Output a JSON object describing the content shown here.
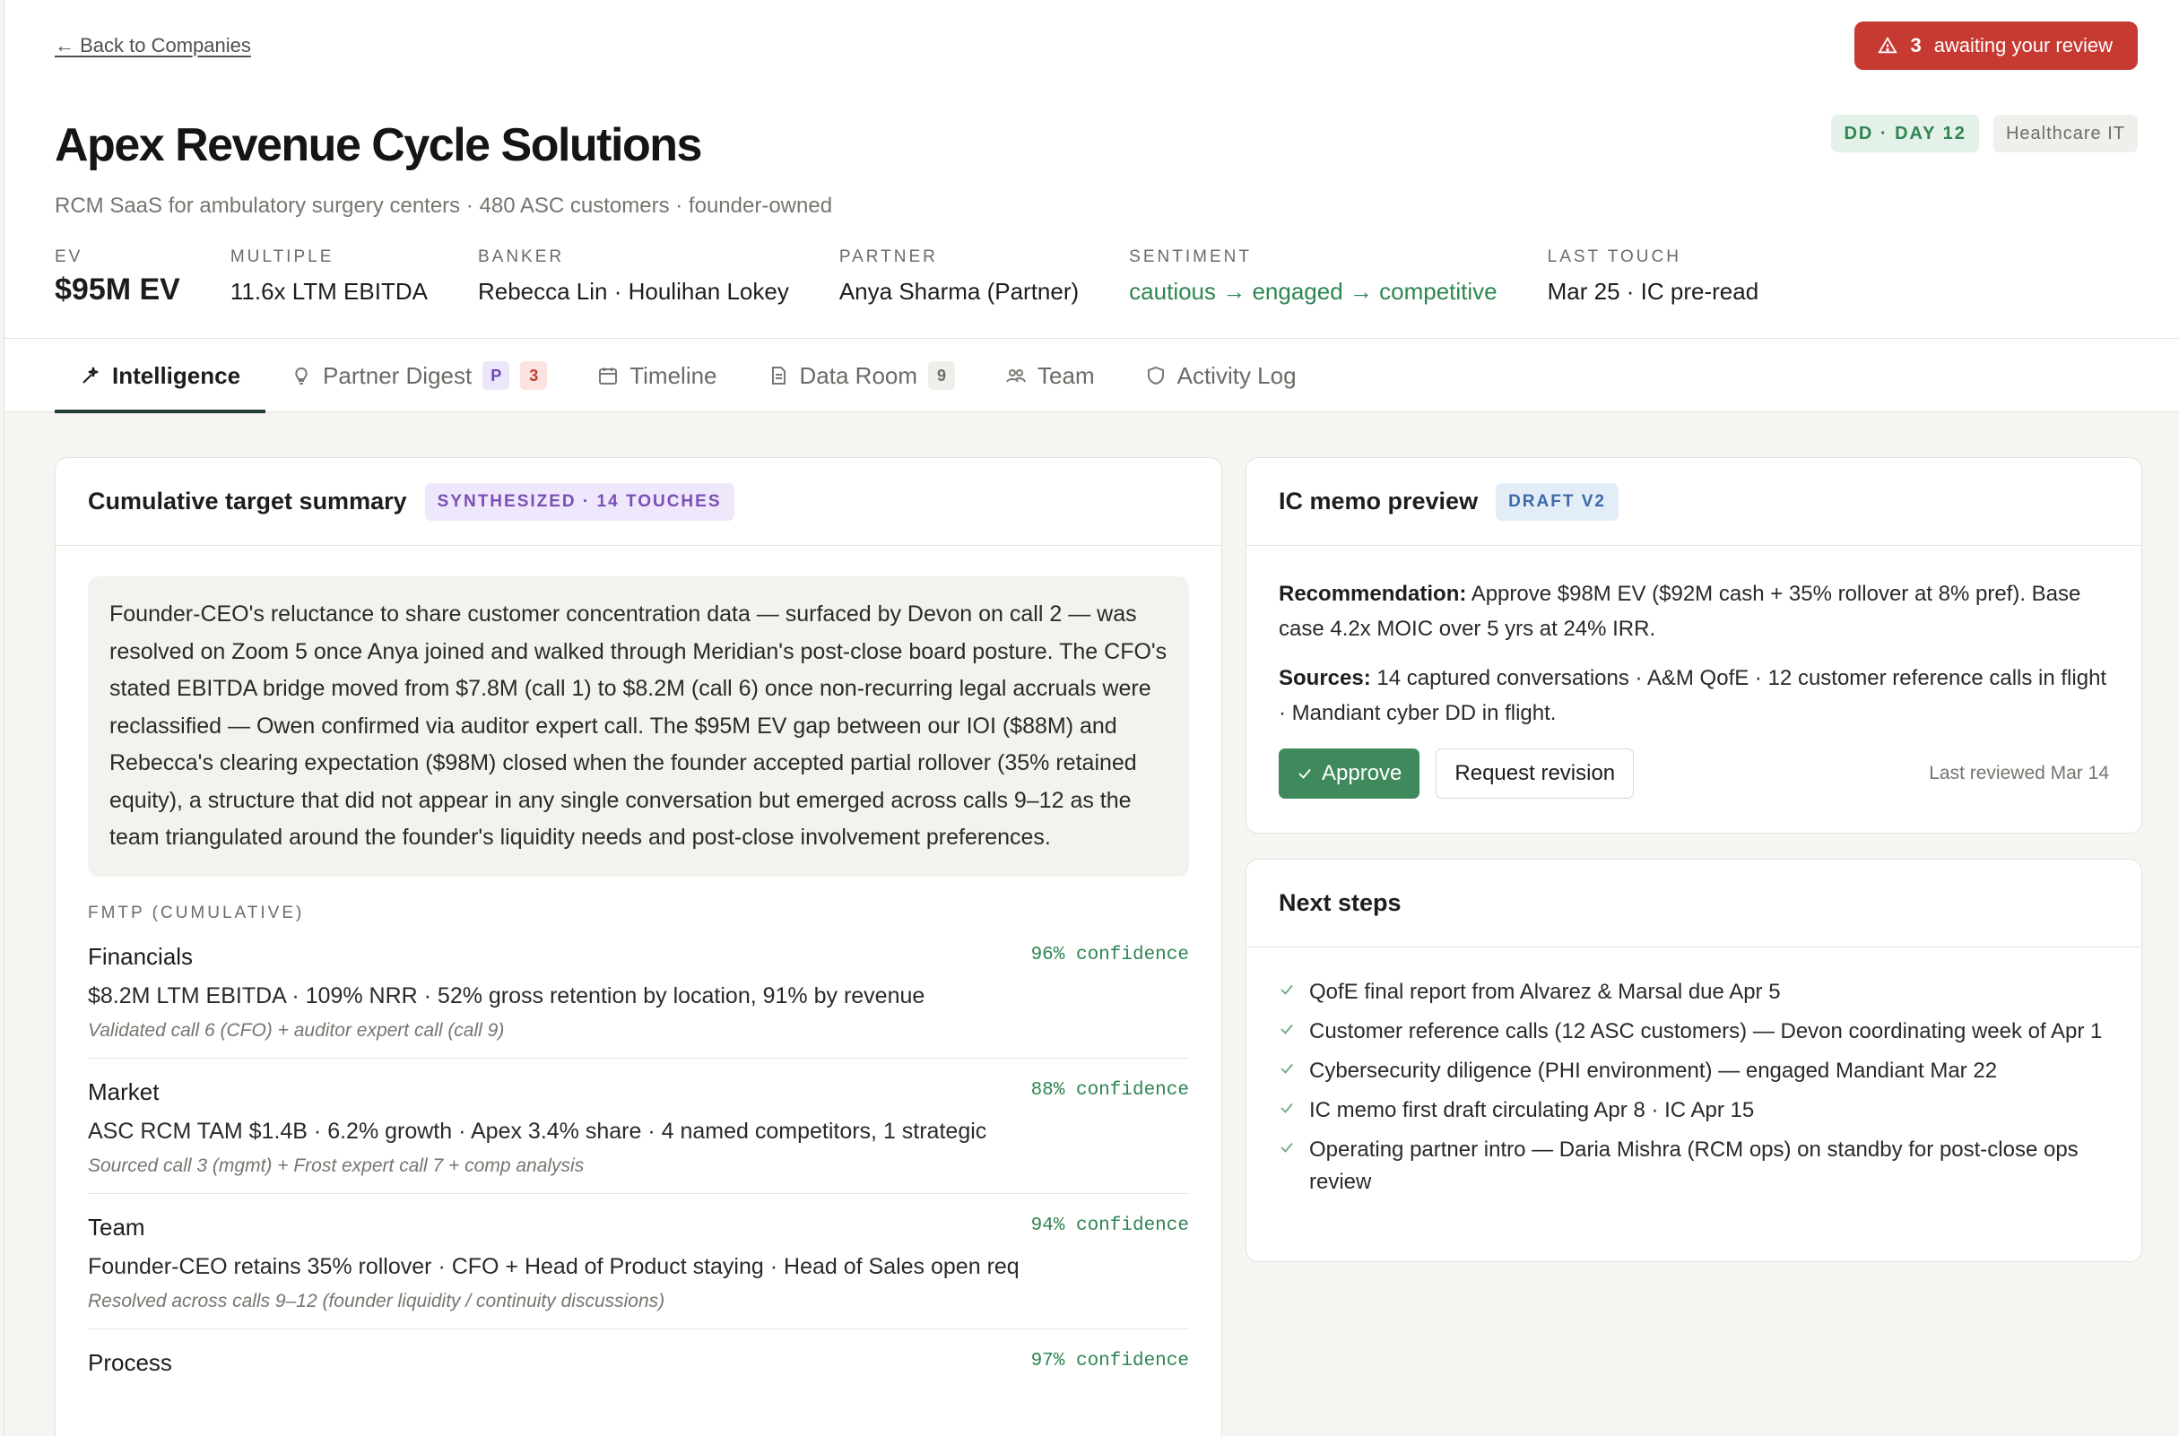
{
  "header": {
    "back_label": "← Back to Companies",
    "alert": {
      "count": "3",
      "text": "awaiting your review"
    },
    "stage_tag": "DD · DAY 12",
    "sector_tag": "Healthcare IT",
    "company_name": "Apex Revenue Cycle Solutions",
    "subtitle": "RCM SaaS for ambulatory surgery centers · 480 ASC customers · founder-owned",
    "meta": [
      {
        "label": "EV",
        "value": "$95M EV"
      },
      {
        "label": "MULTIPLE",
        "value": "11.6x LTM EBITDA"
      },
      {
        "label": "BANKER",
        "value": "Rebecca Lin · Houlihan Lokey"
      },
      {
        "label": "PARTNER",
        "value": "Anya Sharma (Partner)"
      },
      {
        "label": "SENTIMENT",
        "value": "cautious → engaged → competitive"
      },
      {
        "label": "LAST TOUCH",
        "value": "Mar 25 · IC pre-read"
      }
    ]
  },
  "tabs": [
    {
      "label": "Intelligence",
      "icon": "sparkle-icon"
    },
    {
      "label": "Partner Digest",
      "icon": "lightbulb-icon",
      "badge_p": "P",
      "badge_count": "3"
    },
    {
      "label": "Timeline",
      "icon": "calendar-icon"
    },
    {
      "label": "Data Room",
      "icon": "document-icon",
      "badge_count": "9"
    },
    {
      "label": "Team",
      "icon": "people-icon"
    },
    {
      "label": "Activity Log",
      "icon": "shield-icon"
    }
  ],
  "summary": {
    "title": "Cumulative target summary",
    "pill": "SYNTHESIZED · 14 TOUCHES",
    "text": "Founder-CEO's reluctance to share customer concentration data — surfaced by Devon on call 2 — was resolved on Zoom 5 once Anya joined and walked through Meridian's post-close board posture. The CFO's stated EBITDA bridge moved from $7.8M (call 1) to $8.2M (call 6) once non-recurring legal accruals were reclassified — Owen confirmed via auditor expert call. The $95M EV gap between our IOI ($88M) and Rebecca's clearing expectation ($98M) closed when the founder accepted partial rollover (35% retained equity), a structure that did not appear in any single conversation but emerged across calls 9–12 as the team triangulated around the founder's liquidity needs and post-close involvement preferences.",
    "fmtp_label": "FMTP (CUMULATIVE)",
    "fmtp": [
      {
        "name": "Financials",
        "confidence": "96% confidence",
        "desc": "$8.2M LTM EBITDA · 109% NRR · 52% gross retention by location, 91% by revenue",
        "source": "Validated call 6 (CFO) + auditor expert call (call 9)"
      },
      {
        "name": "Market",
        "confidence": "88% confidence",
        "desc": "ASC RCM TAM $1.4B · 6.2% growth · Apex 3.4% share · 4 named competitors, 1 strategic",
        "source": "Sourced call 3 (mgmt) + Frost expert call 7 + comp analysis"
      },
      {
        "name": "Team",
        "confidence": "94% confidence",
        "desc": "Founder-CEO retains 35% rollover · CFO + Head of Product staying · Head of Sales open req",
        "source": "Resolved across calls 9–12 (founder liquidity / continuity discussions)"
      },
      {
        "name": "Process",
        "confidence": "97% confidence",
        "desc": "",
        "source": ""
      }
    ]
  },
  "memo": {
    "title": "IC memo preview",
    "pill": "DRAFT V2",
    "rec_label": "Recommendation:",
    "rec_text": " Approve $98M EV ($92M cash + 35% rollover at 8% pref). Base case 4.2x MOIC over 5 yrs at 24% IRR.",
    "src_label": "Sources:",
    "src_text": " 14 captured conversations · A&M QofE · 12 customer reference calls in flight · Mandiant cyber DD in flight.",
    "approve_label": "Approve",
    "revision_label": "Request revision",
    "last_reviewed": "Last reviewed Mar 14"
  },
  "next_steps": {
    "title": "Next steps",
    "items": [
      "QofE final report from Alvarez & Marsal due Apr 5",
      "Customer reference calls (12 ASC customers) — Devon coordinating week of Apr 1",
      "Cybersecurity diligence (PHI environment) — engaged Mandiant Mar 22",
      "IC memo first draft circulating Apr 8 · IC Apr 15",
      "Operating partner intro — Daria Mishra (RCM ops) on standby for post-close ops review"
    ]
  },
  "colors": {
    "accent_green": "#2f8552",
    "alert_red": "#c73a32",
    "tab_underline": "#1f3d36"
  }
}
